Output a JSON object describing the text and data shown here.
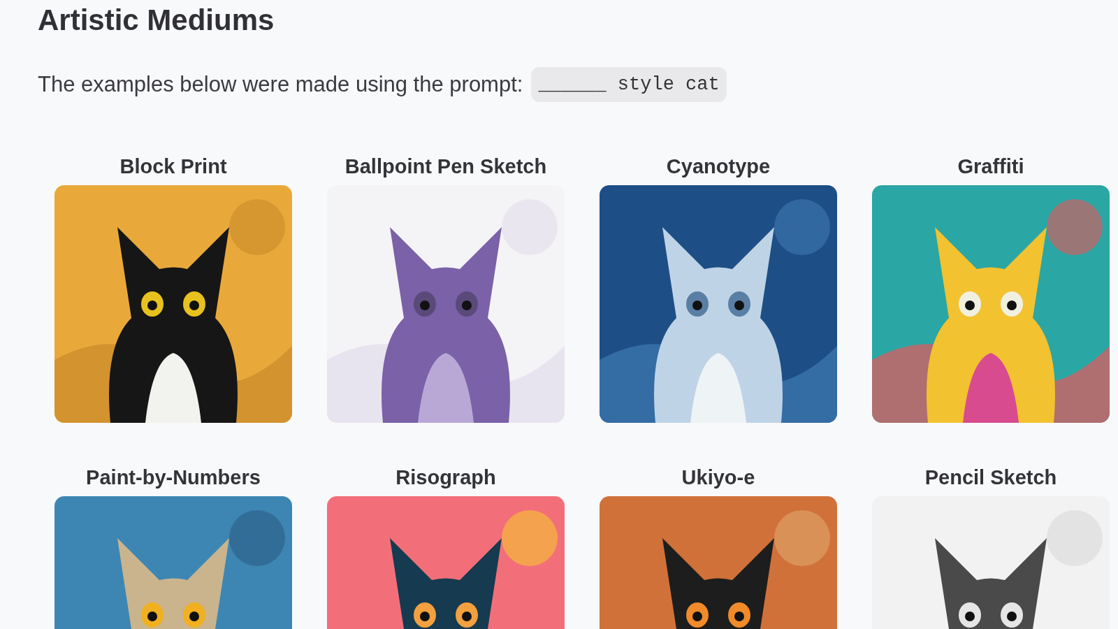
{
  "title": "Artistic Mediums",
  "intro": {
    "text": "The examples below were made using the prompt:",
    "prompt": "______ style cat"
  },
  "examples": [
    {
      "label": "Block Print",
      "kind": "picture"
    },
    {
      "label": "Ballpoint Pen Sketch",
      "kind": "picture"
    },
    {
      "label": "Cyanotype",
      "kind": "picture"
    },
    {
      "label": "Graffiti",
      "kind": "picture"
    },
    {
      "label": "Paint-by-Numbers",
      "kind": "picture"
    },
    {
      "label": "Risograph",
      "kind": "picture"
    },
    {
      "label": "Ukiyo-e",
      "kind": "picture"
    },
    {
      "label": "Pencil Sketch",
      "kind": "picture"
    }
  ]
}
